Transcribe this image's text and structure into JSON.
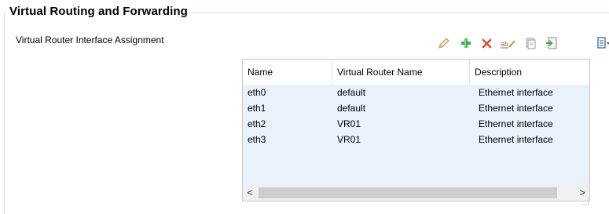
{
  "group": {
    "title": "Virtual Routing and Forwarding"
  },
  "section": {
    "label": "Virtual Router Interface Assignment"
  },
  "toolbar": {
    "icons": [
      "edit-icon",
      "add-icon",
      "delete-icon",
      "rename-icon",
      "copy-icon",
      "import-icon",
      "options-icon"
    ]
  },
  "table": {
    "columns": [
      "Name",
      "Virtual Router Name",
      "Description"
    ],
    "rows": [
      [
        "eth0",
        "default",
        "Ethernet interface"
      ],
      [
        "eth1",
        "default",
        "Ethernet interface"
      ],
      [
        "eth2",
        "VR01",
        "Ethernet interface"
      ],
      [
        "eth3",
        "VR01",
        "Ethernet interface"
      ]
    ]
  },
  "scrollbar": {
    "left": "<",
    "right": ">"
  },
  "colors": {
    "selection_bg": "#e9f1fb",
    "border": "#d5dfe5",
    "add": "#3fae49",
    "delete": "#e0482b"
  }
}
